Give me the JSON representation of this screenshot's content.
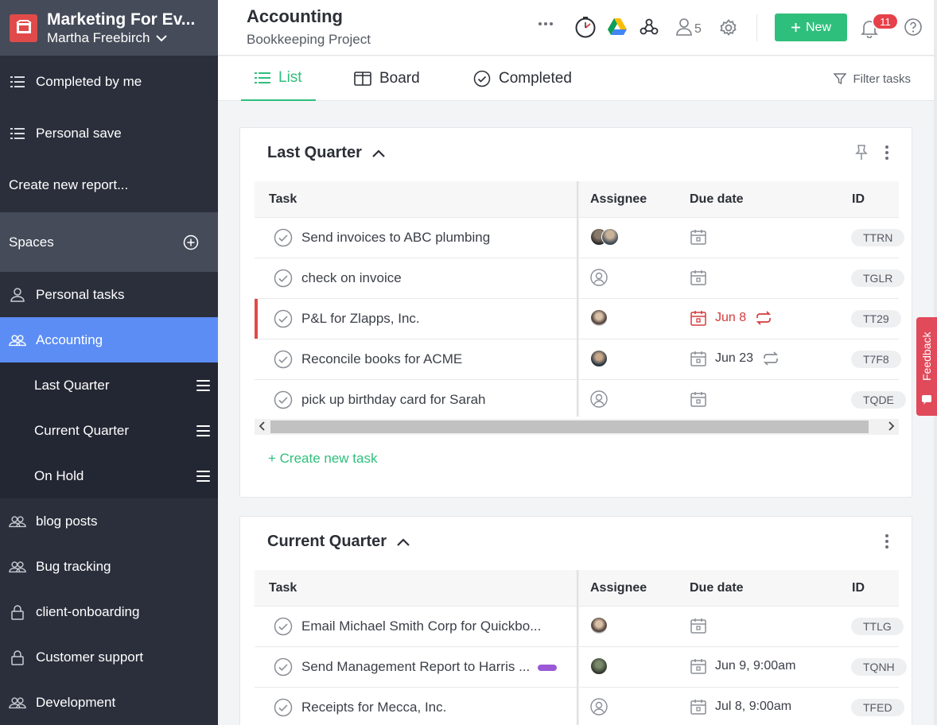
{
  "workspace": {
    "name": "Marketing For Ev...",
    "user": "Martha Freebirch"
  },
  "sidebar": {
    "reports": [
      {
        "label": "Completed by me",
        "icon": "list-icon"
      },
      {
        "label": "Personal save",
        "icon": "list-icon"
      },
      {
        "label": "Create new report..."
      }
    ],
    "spaces_label": "Spaces",
    "spaces": [
      {
        "label": "Personal tasks",
        "icon": "user-icon"
      },
      {
        "label": "Accounting",
        "icon": "users-icon",
        "active": true
      },
      {
        "label": "blog posts",
        "icon": "users-icon"
      },
      {
        "label": "Bug tracking",
        "icon": "users-icon"
      },
      {
        "label": "client-onboarding",
        "icon": "lock-icon"
      },
      {
        "label": "Customer support",
        "icon": "lock-icon"
      },
      {
        "label": "Development",
        "icon": "users-icon"
      }
    ],
    "sublists": [
      {
        "label": "Last Quarter"
      },
      {
        "label": "Current Quarter"
      },
      {
        "label": "On Hold"
      }
    ]
  },
  "header": {
    "title": "Accounting",
    "subtitle": "Bookkeeping Project",
    "members_count": "5",
    "new_label": "New",
    "notifications_count": "11"
  },
  "tabs": [
    {
      "label": "List",
      "icon": "list-icon",
      "active": true
    },
    {
      "label": "Board",
      "icon": "board-icon"
    },
    {
      "label": "Completed",
      "icon": "check-circle-icon"
    }
  ],
  "filter_label": "Filter tasks",
  "columns": {
    "task": "Task",
    "assignee": "Assignee",
    "due": "Due date",
    "id": "ID"
  },
  "sections": [
    {
      "title": "Last Quarter",
      "tasks": [
        {
          "name": "Send invoices to ABC plumbing",
          "assignee": "two-avatars",
          "due": "",
          "recurring": false,
          "id": "TTRN"
        },
        {
          "name": "check on invoice",
          "assignee": "unassigned",
          "due": "",
          "recurring": false,
          "id": "TGLR"
        },
        {
          "name": "P&L for Zlapps, Inc.",
          "assignee": "avatar",
          "due": "Jun 8",
          "recurring": true,
          "overdue": true,
          "id": "TT29"
        },
        {
          "name": "Reconcile books for ACME",
          "assignee": "avatar",
          "due": "Jun 23",
          "recurring": true,
          "id": "T7F8"
        },
        {
          "name": "pick up birthday card for Sarah",
          "assignee": "unassigned",
          "due": "",
          "recurring": false,
          "id": "TQDE"
        }
      ],
      "create_label": "+ Create new task"
    },
    {
      "title": "Current Quarter",
      "tasks": [
        {
          "name": "Email Michael Smith Corp for Quickbo...",
          "assignee": "avatar",
          "due": "",
          "id": "TTLG"
        },
        {
          "name": "Send Management Report to Harris ...",
          "assignee": "avatar",
          "due": "Jun 9, 9:00am",
          "tag_color": "#9b59d6",
          "id": "TQNH"
        },
        {
          "name": "Receipts for Mecca, Inc.",
          "assignee": "unassigned",
          "due": "Jul 8, 9:00am",
          "id": "TFED"
        }
      ]
    }
  ],
  "feedback_label": "Feedback",
  "colors": {
    "accent": "#2fbf7c",
    "sidebar": "#2a2f3b",
    "active_space": "#5b8df5",
    "danger": "#e04a4a"
  }
}
